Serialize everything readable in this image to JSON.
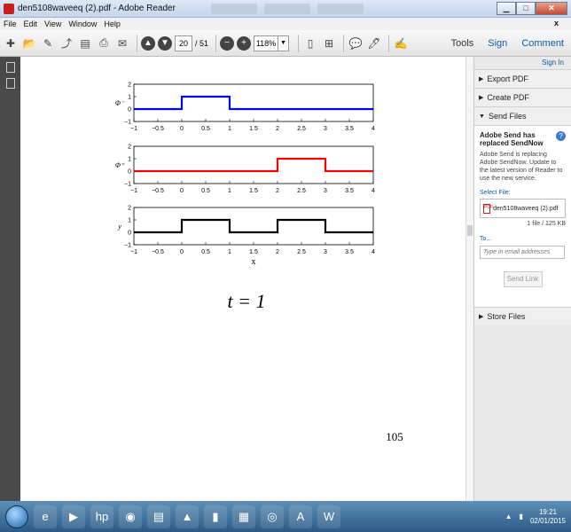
{
  "window": {
    "title": "den5108waveeq (2).pdf - Adobe Reader"
  },
  "menu": [
    "File",
    "Edit",
    "View",
    "Window",
    "Help"
  ],
  "menu_close": "x",
  "toolbar": {
    "page_current": "20",
    "page_total": "/ 51",
    "zoom": "118%",
    "tools": "Tools",
    "sign": "Sign",
    "comment": "Comment"
  },
  "sidepanel": {
    "sign_in": "Sign In",
    "export_pdf": "Export PDF",
    "create_pdf": "Create PDF",
    "send_files": "Send Files",
    "send_header": "Adobe Send has replaced SendNow",
    "send_desc": "Adobe Send is replacing Adobe SendNow. Update to the latest version of Reader to use the new service.",
    "select_file": "Select File:",
    "file_name": "den5108waveeq (2).pdf",
    "file_count": "1 file / 125 KB",
    "to_label": "To...",
    "email_placeholder": "Type in email addresses",
    "send_link": "Send Link",
    "store_files": "Store Files"
  },
  "document": {
    "caption": "t = 1",
    "page_number": "105",
    "x_axis_label": "x"
  },
  "chart_data": [
    {
      "type": "line",
      "ylabel": "Φ⁻",
      "color": "#0000ff",
      "xlim": [
        -1,
        4
      ],
      "ylim": [
        -1,
        2
      ],
      "x_ticks": [
        "-1",
        "-0.5",
        "0",
        "0.5",
        "1",
        "1.5",
        "2",
        "2.5",
        "3",
        "3.5",
        "4"
      ],
      "y_ticks": [
        "2",
        "1",
        "0",
        "-1"
      ],
      "x": [
        -1,
        0,
        0,
        1,
        1,
        4
      ],
      "y": [
        0,
        0,
        1,
        1,
        0,
        0
      ]
    },
    {
      "type": "line",
      "ylabel": "Φ⁺",
      "color": "#ff0000",
      "xlim": [
        -1,
        4
      ],
      "ylim": [
        -1,
        2
      ],
      "x_ticks": [
        "-1",
        "-0.5",
        "0",
        "0.5",
        "1",
        "1.5",
        "2",
        "2.5",
        "3",
        "3.5",
        "4"
      ],
      "y_ticks": [
        "2",
        "1",
        "0",
        "-1"
      ],
      "x": [
        -1,
        2,
        2,
        3,
        3,
        4
      ],
      "y": [
        0,
        0,
        1,
        1,
        0,
        0
      ]
    },
    {
      "type": "line",
      "ylabel": "y",
      "color": "#000000",
      "xlim": [
        -1,
        4
      ],
      "ylim": [
        -1,
        2
      ],
      "x_ticks": [
        "-1",
        "-0.5",
        "0",
        "0.5",
        "1",
        "1.5",
        "2",
        "2.5",
        "3",
        "3.5",
        "4"
      ],
      "y_ticks": [
        "2",
        "1",
        "0",
        "-1"
      ],
      "x": [
        -1,
        0,
        0,
        1,
        1,
        2,
        2,
        3,
        3,
        4
      ],
      "y": [
        0,
        0,
        1,
        1,
        0,
        0,
        1,
        1,
        0,
        0
      ]
    }
  ],
  "taskbar": {
    "time": "19:21",
    "date": "02/01/2015"
  }
}
